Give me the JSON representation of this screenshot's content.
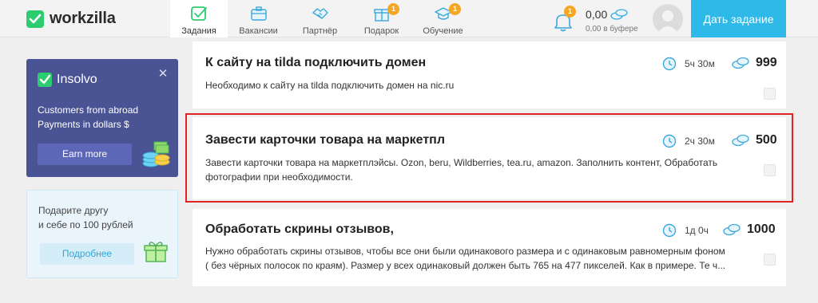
{
  "brand": {
    "name": "workzilla",
    "accent": "#2ecc71"
  },
  "nav": {
    "items": [
      {
        "label": "Задания",
        "icon": "checkbox-icon",
        "active": true
      },
      {
        "label": "Вакансии",
        "icon": "briefcase-icon"
      },
      {
        "label": "Партнёр",
        "icon": "handshake-icon"
      },
      {
        "label": "Подарок",
        "icon": "gift-icon",
        "badge": "1"
      },
      {
        "label": "Обучение",
        "icon": "graduation-cap-icon",
        "badge": "1"
      }
    ]
  },
  "notifications": {
    "badge": "1"
  },
  "balance": {
    "amount": "0,00",
    "buffer": "0,00 в буфере"
  },
  "header": {
    "give_task_label": "Дать задание"
  },
  "promo_insolvo": {
    "brand": "Insolvo",
    "line1": "Customers from abroad",
    "line2": "Payments in dollars $",
    "button": "Earn more"
  },
  "promo_referral": {
    "line1": "Подарите другу",
    "line2": "и себе по 100 рублей",
    "button": "Подробнее"
  },
  "tasks": [
    {
      "title": "К сайту на tilda подключить домен",
      "description": "Необходимо к сайту на tilda подключить домен на nic.ru",
      "time": "5ч 30м",
      "price": "999"
    },
    {
      "title": "Завести карточки товара на маркетпл",
      "description_line1": "Завести карточки товара на маркетплэйсы. Ozon, beru, Wildberries, tea.ru, amazon. Заполнить контент, Обработать",
      "description_line2": "фотографии при необходимости.",
      "time": "2ч 30м",
      "price": "500"
    },
    {
      "title": "Обработать скрины отзывов,",
      "description_line1": "Нужно обработать скрины отзывов, чтобы все они были одинакового размера и с одинаковым равномерным фоном",
      "description_line2": "( без чёрных полосок по краям). Размер у всех одинаковый должен быть 765 на 477 пикселей. Как в примере. Те ч...",
      "time": "1д 0ч",
      "price": "1000"
    }
  ],
  "colors": {
    "highlight": "#e02424",
    "primary_button": "#2fb9e8",
    "badge": "#f5a623",
    "promo_bg": "#4a5494"
  }
}
